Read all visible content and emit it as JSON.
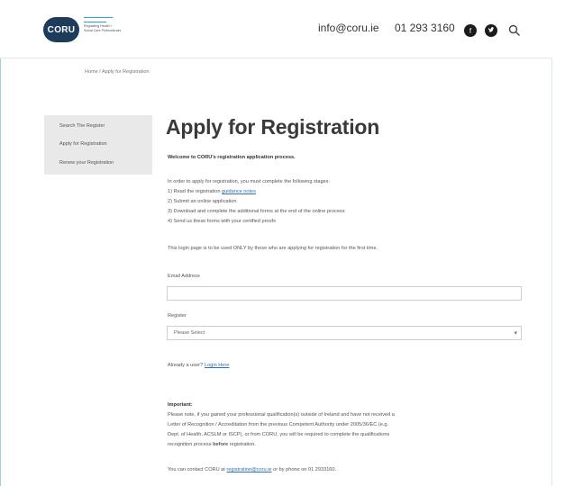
{
  "header": {
    "logo_text": "CORU",
    "tagline_lines": [
      "Regulating Health +",
      "Social Care Professionals"
    ],
    "email": "info@coru.ie",
    "phone": "01 293 3160"
  },
  "breadcrumb": "Home / Apply for Registration",
  "sidebar": {
    "items": [
      {
        "label": "Search The Register"
      },
      {
        "label": "Apply for Registration"
      },
      {
        "label": "Renew your Registration"
      }
    ]
  },
  "main": {
    "title": "Apply for Registration",
    "welcome": "Welcome to CORU's registration application process.",
    "intro": "In order to apply for registration, you must complete the following stages:",
    "steps": {
      "s1_prefix": "1) Read the registration ",
      "s1_link": "guidance notes",
      "s2": "2) Submit an online application",
      "s3": "3) Download and complete the additional forms at the end of the online process",
      "s4": "4) Send us these forms with your certified proofs"
    },
    "login_note": "This login page is to be used ONLY by those who are applying for registration for the first time.",
    "email_label": "Email Address",
    "email_value": "",
    "register_label": "Register",
    "register_selected": "Please Select",
    "already_user": "Already a user?",
    "login_link": "Login Here",
    "important_heading": "Important:",
    "important_lines": [
      "Please note, if you gained your professional qualification(s) outside of Ireland and have not received a",
      "Letter of Recognition / Accreditation from the previous Competent Authority under 2005/36/EC (e.g.",
      "Dept. of Health, ACSLM or ISCP), or from CORU, you will be required to complete the qualifications"
    ],
    "important_last_prefix": "recognition process ",
    "important_last_bold": "before",
    "important_last_suffix": " registration.",
    "contact_prefix": "You can contact CORU at ",
    "contact_link": "registration@coru.ie",
    "contact_suffix": " or by phone on 01 2933160."
  },
  "colors": {
    "brand_navy": "#1d3c5c",
    "brand_teal": "#2aa2c9",
    "link": "#2f6fb3",
    "sidebar_bg": "#e9e9e9"
  },
  "icons": [
    "facebook-icon",
    "twitter-icon",
    "search-icon",
    "chevron-down-icon"
  ]
}
